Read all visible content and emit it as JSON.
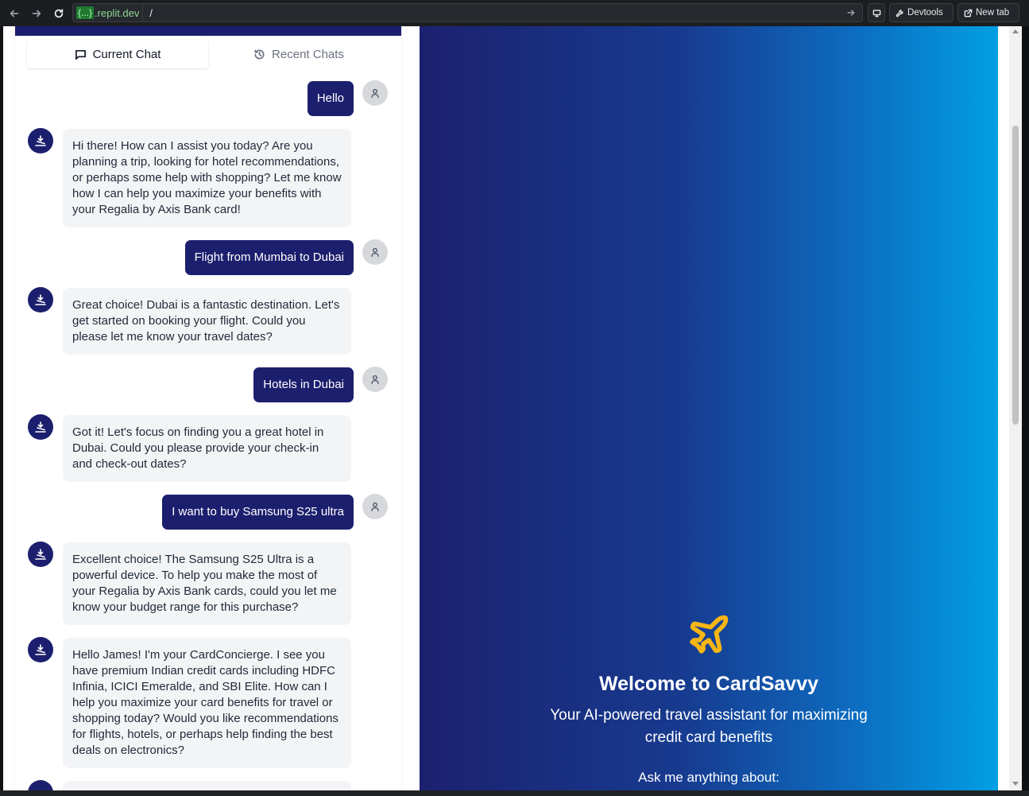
{
  "browser": {
    "url_chip": "{...}",
    "url_host": ".replit.dev",
    "url_path": "/",
    "devtools_label": "Devtools",
    "newtab_label": "New tab"
  },
  "chat": {
    "tabs": [
      {
        "label": "Current Chat",
        "active": true
      },
      {
        "label": "Recent Chats",
        "active": false
      }
    ],
    "messages": [
      {
        "role": "user",
        "text": "Hello"
      },
      {
        "role": "bot",
        "text": "Hi there! How can I assist you today? Are you planning a trip, looking for hotel recommendations, or perhaps some help with shopping? Let me know how I can help you maximize your benefits with your Regalia by Axis Bank card!"
      },
      {
        "role": "user",
        "text": "Flight from Mumbai to Dubai"
      },
      {
        "role": "bot",
        "text": "Great choice! Dubai is a fantastic destination. Let's get started on booking your flight. Could you please let me know your travel dates?"
      },
      {
        "role": "user",
        "text": "Hotels in Dubai"
      },
      {
        "role": "bot",
        "text": "Got it! Let's focus on finding you a great hotel in Dubai. Could you please provide your check-in and check-out dates?"
      },
      {
        "role": "user",
        "text": "I want to buy Samsung S25 ultra"
      },
      {
        "role": "bot",
        "text": "Excellent choice! The Samsung S25 Ultra is a powerful device. To help you make the most of your Regalia by Axis Bank cards, could you let me know your budget range for this purchase?"
      },
      {
        "role": "bot",
        "text": "Hello James! I'm your CardConcierge. I see you have premium Indian credit cards including HDFC Infinia, ICICI Emeralde, and SBI Elite. How can I help you maximize your card benefits for travel or shopping today? Would you like recommendations for flights, hotels, or perhaps help finding the best deals on electronics?"
      }
    ]
  },
  "hero": {
    "title": "Welcome to CardSavvy",
    "subtitle": "Your AI-powered travel assistant for maximizing credit card benefits",
    "ask": "Ask me anything about:"
  },
  "colors": {
    "brand_navy": "#1c1f6e",
    "accent_yellow": "#f7b614",
    "gradient_end": "#019fe3"
  }
}
